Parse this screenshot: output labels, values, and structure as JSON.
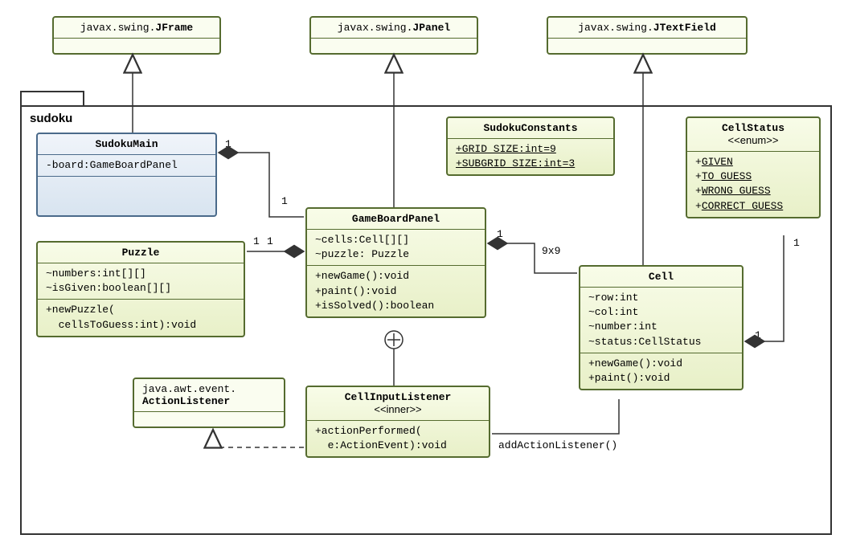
{
  "package": {
    "name": "sudoku"
  },
  "external": {
    "jframe": {
      "pkg": "javax.swing.",
      "name": "JFrame"
    },
    "jpanel": {
      "pkg": "javax.swing.",
      "name": "JPanel"
    },
    "jtextfield": {
      "pkg": "javax.swing.",
      "name": "JTextField"
    },
    "actionlistener": {
      "pkg": "java.awt.event.",
      "name": "ActionListener"
    }
  },
  "classes": {
    "sudokuMain": {
      "name": "SudokuMain",
      "attrs": [
        "-board:GameBoardPanel"
      ]
    },
    "sudokuConstants": {
      "name": "SudokuConstants",
      "attrs": [
        "+GRID_SIZE:int=9",
        "+SUBGRID_SIZE:int=3"
      ]
    },
    "cellStatus": {
      "name": "CellStatus",
      "stereo": "<<enum>>",
      "values": [
        "+GIVEN",
        "+TO_GUESS",
        "+WRONG_GUESS",
        "+CORRECT_GUESS"
      ]
    },
    "puzzle": {
      "name": "Puzzle",
      "attrs": [
        "~numbers:int[][]",
        "~isGiven:boolean[][]"
      ],
      "ops": [
        "+newPuzzle(\n  cellsToGuess:int):void"
      ]
    },
    "gameBoardPanel": {
      "name": "GameBoardPanel",
      "attrs": [
        "~cells:Cell[][]",
        "~puzzle: Puzzle"
      ],
      "ops": [
        "+newGame():void",
        "+paint():void",
        "+isSolved():boolean"
      ]
    },
    "cell": {
      "name": "Cell",
      "attrs": [
        "~row:int",
        "~col:int",
        "~number:int",
        "~status:CellStatus"
      ],
      "ops": [
        "+newGame():void",
        "+paint():void"
      ]
    },
    "cellInputListener": {
      "name": "CellInputListener",
      "stereo": "<<inner>>",
      "ops": [
        "+actionPerformed(\n  e:ActionEvent):void"
      ]
    }
  },
  "multiplicities": {
    "sudokuMain_gbp_1a": "1",
    "sudokuMain_gbp_1b": "1",
    "gbp_puzzle_1a": "1",
    "gbp_puzzle_1b": "1",
    "gbp_cell_1": "1",
    "gbp_cell_9x9": "9x9",
    "cell_status_1a": "1",
    "cell_status_1b": "1"
  },
  "assocLabel": {
    "addActionListener": "addActionListener()"
  }
}
